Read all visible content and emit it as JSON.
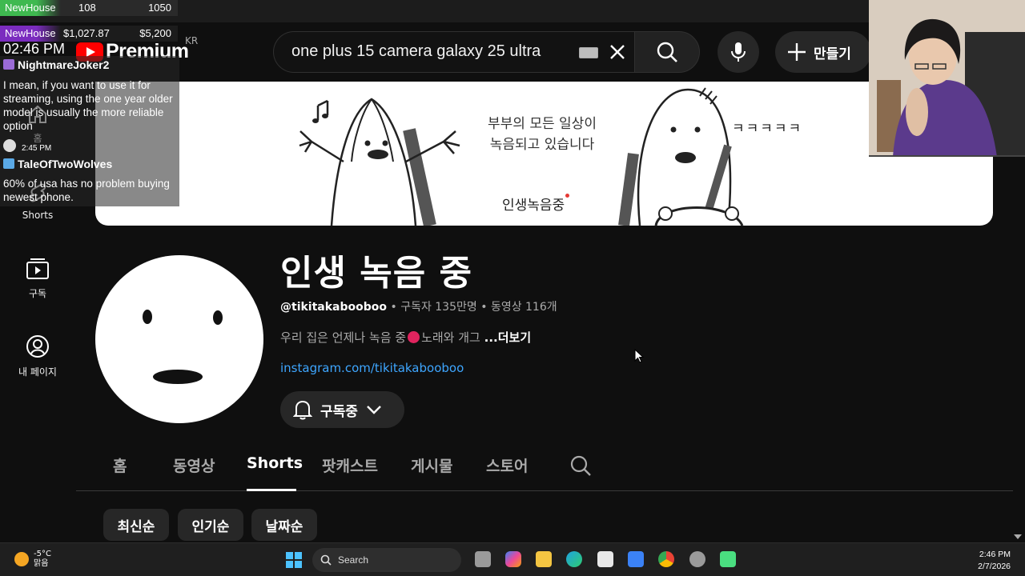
{
  "header": {
    "logo_text": "Premium",
    "country_code": "KR",
    "search_query": "one plus 15 camera galaxy 25 ultra",
    "create_label": "만들기"
  },
  "banner": {
    "caption_line1": "부부의 모든 일상이",
    "caption_line2": "녹음되고 있습니다",
    "laugh": "ㅋㅋㅋㅋㅋ",
    "logo_text": "인생녹음중"
  },
  "guide": {
    "items": [
      {
        "label": "홈",
        "icon": "home-icon"
      },
      {
        "label": "Shorts",
        "icon": "shorts-icon"
      },
      {
        "label": "구독",
        "icon": "subscriptions-icon"
      },
      {
        "label": "내 페이지",
        "icon": "you-icon"
      }
    ]
  },
  "overlay": {
    "ticker1": {
      "label": "NewHouse",
      "value1": "108",
      "value2": "1050"
    },
    "ticker2": {
      "label": "NewHouse",
      "value1": "$1,027.87",
      "value2": "$5,200"
    },
    "time": "02:46 PM",
    "chat": [
      {
        "user": "NightmareJoker2",
        "message": "I mean, if you want to use it for streaming, using the one year older model is usually the more reliable option",
        "time": "2:45 PM"
      },
      {
        "user": "TaleOfTwoWolves",
        "message": "60% of usa has no problem buying newest phone."
      }
    ]
  },
  "channel": {
    "name": "인생 녹음 중",
    "handle": "@tikitakabooboo",
    "subscribers": "구독자 135만명",
    "videos": "동영상 116개",
    "separator": "•",
    "description": "우리 집은 언제나 녹음 중",
    "description_tail": "노래와 개그",
    "more": "...더보기",
    "link": "instagram.com/tikitakabooboo",
    "subscribed_label": "구독중"
  },
  "tabs": [
    {
      "label": "홈",
      "active": false
    },
    {
      "label": "동영상",
      "active": false
    },
    {
      "label": "Shorts",
      "active": true
    },
    {
      "label": "팟캐스트",
      "active": false
    },
    {
      "label": "게시물",
      "active": false
    },
    {
      "label": "스토어",
      "active": false
    }
  ],
  "chips": [
    "최신순",
    "인기순",
    "날짜순"
  ],
  "taskbar": {
    "temperature": "-5°C",
    "condition": "맑음",
    "search_label": "Search",
    "time": "2:46 PM",
    "date": "2/7/2026"
  },
  "colors": {
    "background": "#0f0f0f",
    "accent_red": "#ff0000",
    "link_blue": "#3ea6ff",
    "chip_bg": "#272727"
  }
}
